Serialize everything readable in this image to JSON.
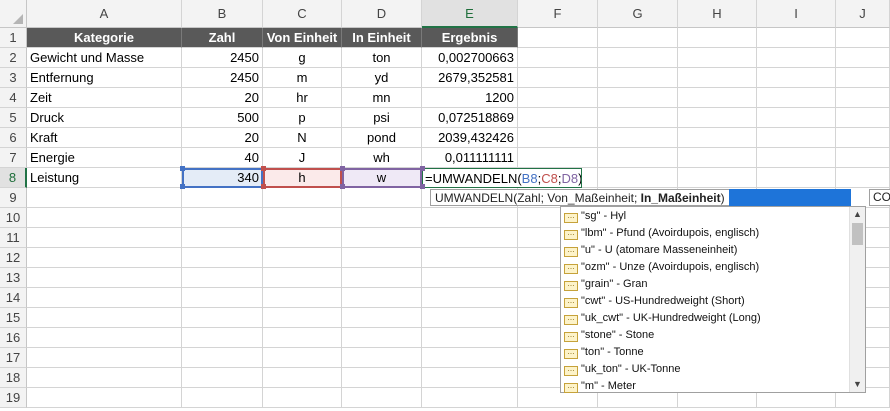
{
  "columns": [
    "A",
    "B",
    "C",
    "D",
    "E",
    "F",
    "G",
    "H",
    "I",
    "J"
  ],
  "rows": [
    "1",
    "2",
    "3",
    "4",
    "5",
    "6",
    "7",
    "8",
    "9",
    "10",
    "11",
    "12",
    "13",
    "14",
    "15",
    "16",
    "17",
    "18",
    "19"
  ],
  "table": {
    "headers": [
      "Kategorie",
      "Zahl",
      "Von Einheit",
      "In Einheit",
      "Ergebnis"
    ],
    "data": [
      [
        "Gewicht und Masse",
        "2450",
        "g",
        "ton",
        "0,002700663"
      ],
      [
        "Entfernung",
        "2450",
        "m",
        "yd",
        "2679,352581"
      ],
      [
        "Zeit",
        "20",
        "hr",
        "mn",
        "1200"
      ],
      [
        "Druck",
        "500",
        "p",
        "psi",
        "0,072518869"
      ],
      [
        "Kraft",
        "20",
        "N",
        "pond",
        "2039,432426"
      ],
      [
        "Energie",
        "40",
        "J",
        "wh",
        "0,011111111"
      ],
      [
        "Leistung",
        "340",
        "h",
        "w",
        ""
      ]
    ]
  },
  "formula": {
    "prefix": "=UMWANDELN(",
    "ref1": "B8",
    "sep1": ";",
    "ref2": "C8",
    "sep2": ";",
    "ref3": "D8",
    "suffix": ")"
  },
  "colors": {
    "ref1": "#4472c4",
    "ref2": "#c0504d",
    "ref3": "#8064a2",
    "accent": "#217346",
    "tooltip_highlight": "#1e74d9"
  },
  "tooltip": {
    "fn": "UMWANDELN(",
    "args": "Zahl; Von_Maßeinheit; ",
    "current": "In_Maßeinheit",
    "close": ")",
    "right_fragment": "CO"
  },
  "autocomplete": [
    "\"sg\" - Hyl",
    "\"lbm\" - Pfund (Avoirdupois, englisch)",
    "\"u\" - U (atomare Masseneinheit)",
    "\"ozm\" - Unze (Avoirdupois, englisch)",
    "\"grain\" - Gran",
    "\"cwt\" - US-Hundredweight (Short)",
    "\"uk_cwt\" - UK-Hundredweight (Long)",
    "\"stone\" - Stone",
    "\"ton\" - Tonne",
    "\"uk_ton\" - UK-Tonne",
    "\"m\" - Meter"
  ],
  "icons": {
    "item": "unit-constant-icon",
    "scroll_up": "▲",
    "scroll_down": "▼"
  }
}
